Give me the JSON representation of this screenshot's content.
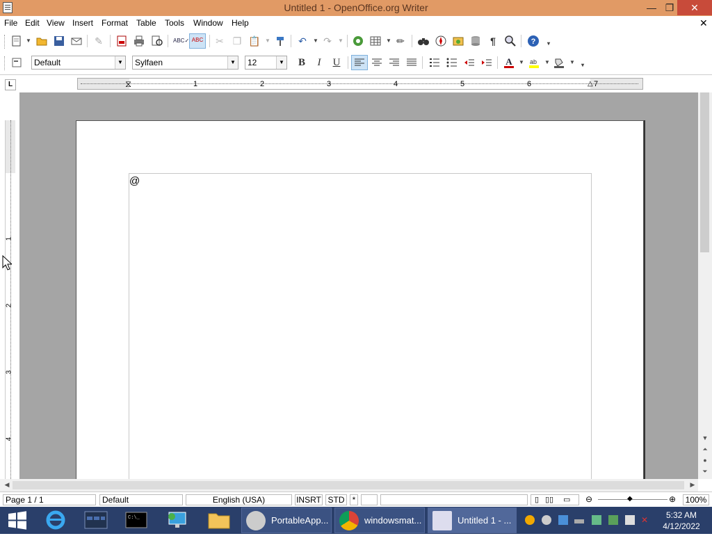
{
  "window": {
    "title": "Untitled 1 - OpenOffice.org Writer",
    "min_glyph": "—",
    "max_glyph": "❐",
    "close_glyph": "✕",
    "doc_close_glyph": "✕"
  },
  "menu": [
    "File",
    "Edit",
    "View",
    "Insert",
    "Format",
    "Table",
    "Tools",
    "Window",
    "Help"
  ],
  "formatting": {
    "paragraph_style": "Default",
    "font_name": "Sylfaen",
    "font_size": "12",
    "bold": "B",
    "italic": "I",
    "underline": "U"
  },
  "ruler": {
    "h_numbers": [
      "1",
      "2",
      "3",
      "4",
      "5",
      "6",
      "7"
    ],
    "v_numbers": [
      "1",
      "2",
      "3",
      "4"
    ],
    "tab_selector": "L"
  },
  "document": {
    "text": "@"
  },
  "status": {
    "page": "Page 1 / 1",
    "style": "Default",
    "language": "English (USA)",
    "insert_mode": "INSRT",
    "selection_mode": "STD",
    "modified": "*",
    "zoom": "100%"
  },
  "taskbar": {
    "items": [
      {
        "label": "PortableApp...",
        "icon": "portableapps-icon"
      },
      {
        "label": "windowsmat...",
        "icon": "chrome-icon"
      },
      {
        "label": "Untitled 1 - ...",
        "icon": "writer-icon"
      }
    ],
    "time": "5:32 AM",
    "date": "4/12/2022"
  },
  "colors": {
    "titlebar": "#e19a65",
    "taskbar": "#2a3f6a",
    "close_button": "#c84b3a",
    "doc_background": "#a5a5a5"
  }
}
